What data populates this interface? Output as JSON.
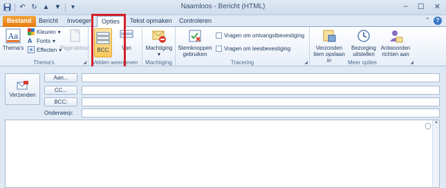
{
  "window": {
    "title": "Naamloos  -  Bericht (HTML)",
    "quick_access": [
      "save-icon",
      "undo-icon",
      "redo-icon",
      "up-icon",
      "down-icon",
      "customize-icon"
    ],
    "controls": [
      "minimize-icon",
      "maximize-icon",
      "close-icon"
    ]
  },
  "tabs": {
    "file": "Bestand",
    "items": [
      "Bericht",
      "Invoegen",
      "Opties",
      "Tekst opmaken",
      "Controleren"
    ],
    "active": "Opties"
  },
  "ribbon": {
    "themes": {
      "themes_label": "Thema's",
      "colors_label": "Kleuren",
      "fonts_label": "Fonts",
      "effects_label": "Effecten",
      "page_color_label": "Paginakleur",
      "group_label": "Thema's"
    },
    "fields": {
      "bcc_label": "BCC",
      "from_label": "Van",
      "group_label": "Velden weergeven"
    },
    "permission": {
      "permission_label": "Machtiging",
      "group_label": "Machtiging"
    },
    "tracking": {
      "voting_label": "Stemknoppen gebruiken",
      "read_receipt_label": "Vragen om ontvangstbevestiging",
      "delivery_receipt_label": "Vragen om leesbevestiging",
      "group_label": "Tracering"
    },
    "more": {
      "save_sent_label": "Verzonden item opslaan in",
      "delay_label": "Bezorging uitstellen",
      "direct_replies_label": "Antwoorden richten aan",
      "group_label": "Meer opties"
    }
  },
  "compose": {
    "send_label": "Verzenden",
    "to_label": "Aan...",
    "cc_label": "CC...",
    "bcc_label": "BCC:",
    "subject_label": "Onderwerp:",
    "to_value": "",
    "cc_value": "",
    "bcc_value": "",
    "subject_value": ""
  },
  "highlight_color": "#d41f27"
}
